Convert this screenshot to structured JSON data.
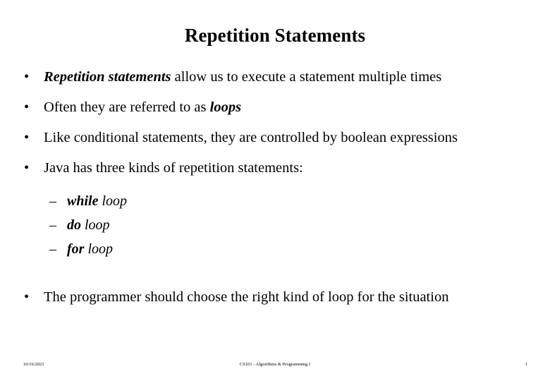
{
  "slide": {
    "title": "Repetition Statements",
    "bullet_marker": "•",
    "sub_marker": "–",
    "bullets": [
      {
        "emphasis": "Repetition statements",
        "text": " allow us to execute a statement multiple times"
      },
      {
        "lead": "Often they are referred to as ",
        "emphasis": "loops"
      },
      {
        "text": "Like conditional statements, they are controlled by boolean expressions"
      },
      {
        "text": "Java has three kinds of repetition statements:"
      },
      {
        "text": "The programmer should choose the right kind of loop for the situation"
      }
    ],
    "sub_bullets": [
      {
        "keyword": "while",
        "label": " loop"
      },
      {
        "keyword": "do",
        "label": " loop"
      },
      {
        "keyword": "for",
        "label": " loop"
      }
    ]
  },
  "footer": {
    "date": "10/16/2021",
    "course": "CS101 - Algorithms & Programming I",
    "page_number": "1"
  }
}
